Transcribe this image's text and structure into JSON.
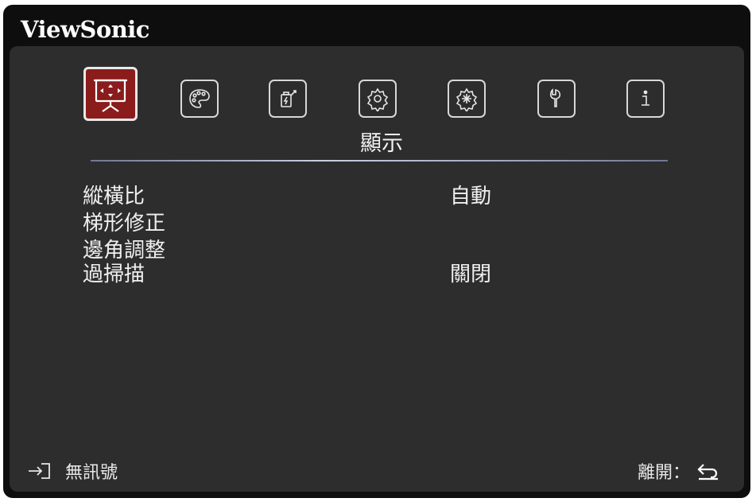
{
  "brand": "ViewSonic",
  "tabs": [
    {
      "icon": "display-icon",
      "active": true
    },
    {
      "icon": "palette-icon",
      "active": false
    },
    {
      "icon": "power-management-icon",
      "active": false
    },
    {
      "icon": "basic-settings-icon",
      "active": false
    },
    {
      "icon": "advanced-settings-icon",
      "active": false
    },
    {
      "icon": "wrench-icon",
      "active": false
    },
    {
      "icon": "info-icon",
      "active": false
    }
  ],
  "active_tab_title": "顯示",
  "menu": {
    "items": [
      {
        "label": "縱橫比",
        "value": "自動"
      },
      {
        "label": "梯形修正",
        "value": ""
      },
      {
        "label": "邊角調整",
        "value": ""
      },
      {
        "label": "過掃描",
        "value": "關閉"
      }
    ]
  },
  "footer": {
    "source_icon": "input-source-icon",
    "source_text": "無訊號",
    "exit_text": "離開：",
    "exit_icon": "return-arrow-icon"
  },
  "colors": {
    "accent": "#8b1c1c",
    "panel": "#2d2d2d",
    "frame": "#0e0e0e",
    "text": "#f0f0f0"
  }
}
